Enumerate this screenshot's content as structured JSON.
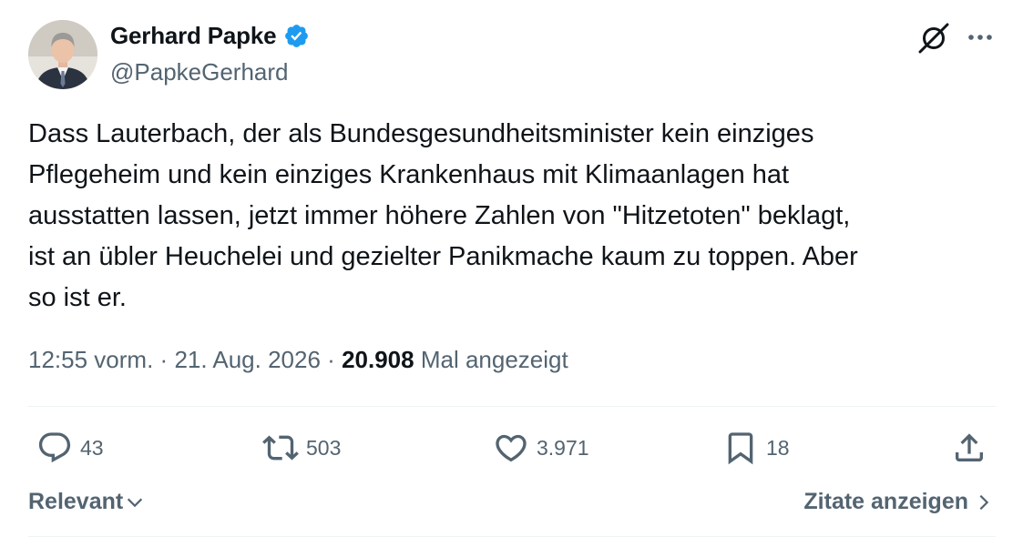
{
  "author": {
    "name": "Gerhard Papke",
    "handle": "@PapkeGerhard",
    "verified_icon": "verified-badge-icon"
  },
  "tweet": {
    "text": "Dass Lauterbach, der als Bundesgesundheitsminister kein einziges\nPflegeheim und kein einziges Krankenhaus mit Klimaanlagen hat\nausstatten lassen, jetzt immer höhere Zahlen von \"Hitzetoten\" beklagt,\nist an übler Heuchelei und gezielter Panikmache kaum zu toppen. Aber\nso ist er."
  },
  "meta": {
    "time": "12:55 vorm.",
    "separator": "·",
    "date": "21. Aug. 2026",
    "views": "20.908",
    "views_label": "Mal angezeigt"
  },
  "actions": {
    "reply": "43",
    "retweet": "503",
    "like": "3.971",
    "bookmark": "18"
  },
  "footer": {
    "sort_label": "Relevant",
    "quotes_label": "Zitate anzeigen"
  },
  "colors": {
    "text": "#0f1419",
    "secondary": "#536471",
    "verified": "#1d9bf0",
    "divider": "#eff3f4"
  }
}
